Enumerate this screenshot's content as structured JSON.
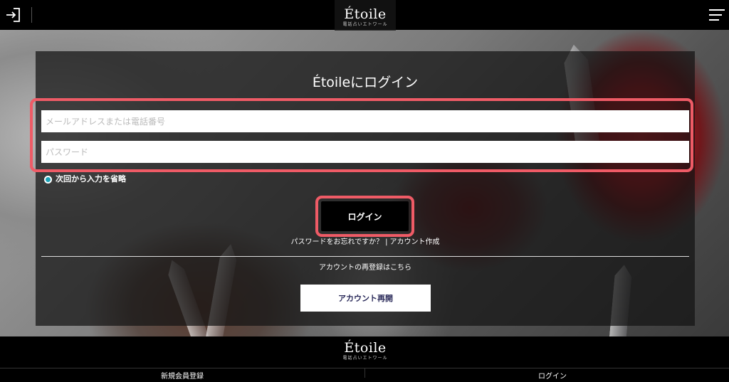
{
  "header": {
    "logo_text": "Étoile",
    "logo_subtext": "電話占いエトワール",
    "login_icon": "login-icon",
    "menu_icon": "hamburger-menu-icon"
  },
  "login": {
    "title": "Étoileにログイン",
    "email_placeholder": "メールアドレスまたは電話番号",
    "password_placeholder": "パスワード",
    "remember_label": "次回から入力を省略",
    "login_button": "ログイン",
    "forgot_password_link": "パスワードをお忘れですか？",
    "separator": "|",
    "create_account_link": "アカウント作成",
    "reregister_text": "アカウントの再登録はこちら",
    "reopen_button": "アカウント再開"
  },
  "footer": {
    "logo_text": "Étoile",
    "logo_subtext": "電話占いエトワール",
    "left_link": "新規会員登録",
    "right_link": "ログイン"
  },
  "colors": {
    "highlight": "#ef5b66",
    "radio_accent": "#1ba3b8",
    "panel_bg": "rgba(20,20,20,0.72)"
  }
}
